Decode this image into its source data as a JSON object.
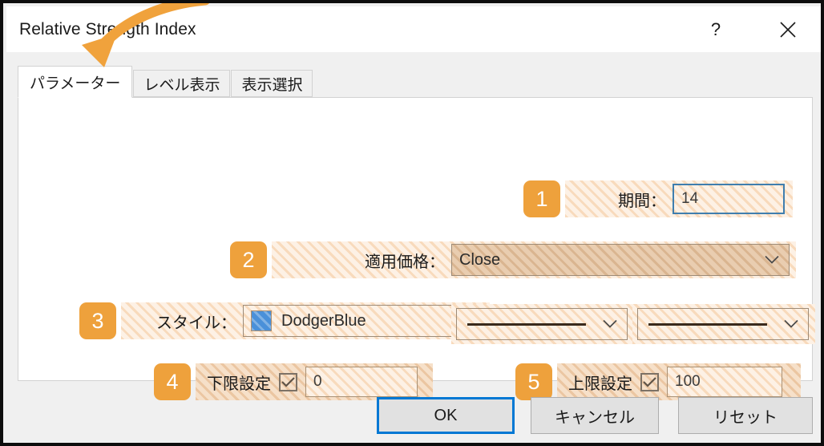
{
  "window": {
    "title": "Relative Strength Index",
    "help_label": "?",
    "close_label": "×"
  },
  "tabs": [
    {
      "label": "パラメーター",
      "active": true
    },
    {
      "label": "レベル表示",
      "active": false
    },
    {
      "label": "表示選択",
      "active": false
    }
  ],
  "parameters": {
    "period": {
      "badge": "1",
      "label": "期間：",
      "value": "14"
    },
    "applied_price": {
      "badge": "2",
      "label": "適用価格：",
      "value": "Close"
    },
    "style": {
      "badge": "3",
      "label": "スタイル：",
      "color_value": "DodgerBlue",
      "color_hex": "#4a90d9",
      "line_width_value": "",
      "line_style_value": ""
    },
    "minimum": {
      "badge": "4",
      "label": "下限設定",
      "checked": true,
      "value": "0"
    },
    "maximum": {
      "badge": "5",
      "label": "上限設定",
      "checked": true,
      "value": "100"
    }
  },
  "footer": {
    "ok_label": "OK",
    "cancel_label": "キャンセル",
    "reset_label": "リセット"
  },
  "annotation": {
    "arrow_color": "#f0a23c",
    "badge_color": "#eea13c"
  }
}
